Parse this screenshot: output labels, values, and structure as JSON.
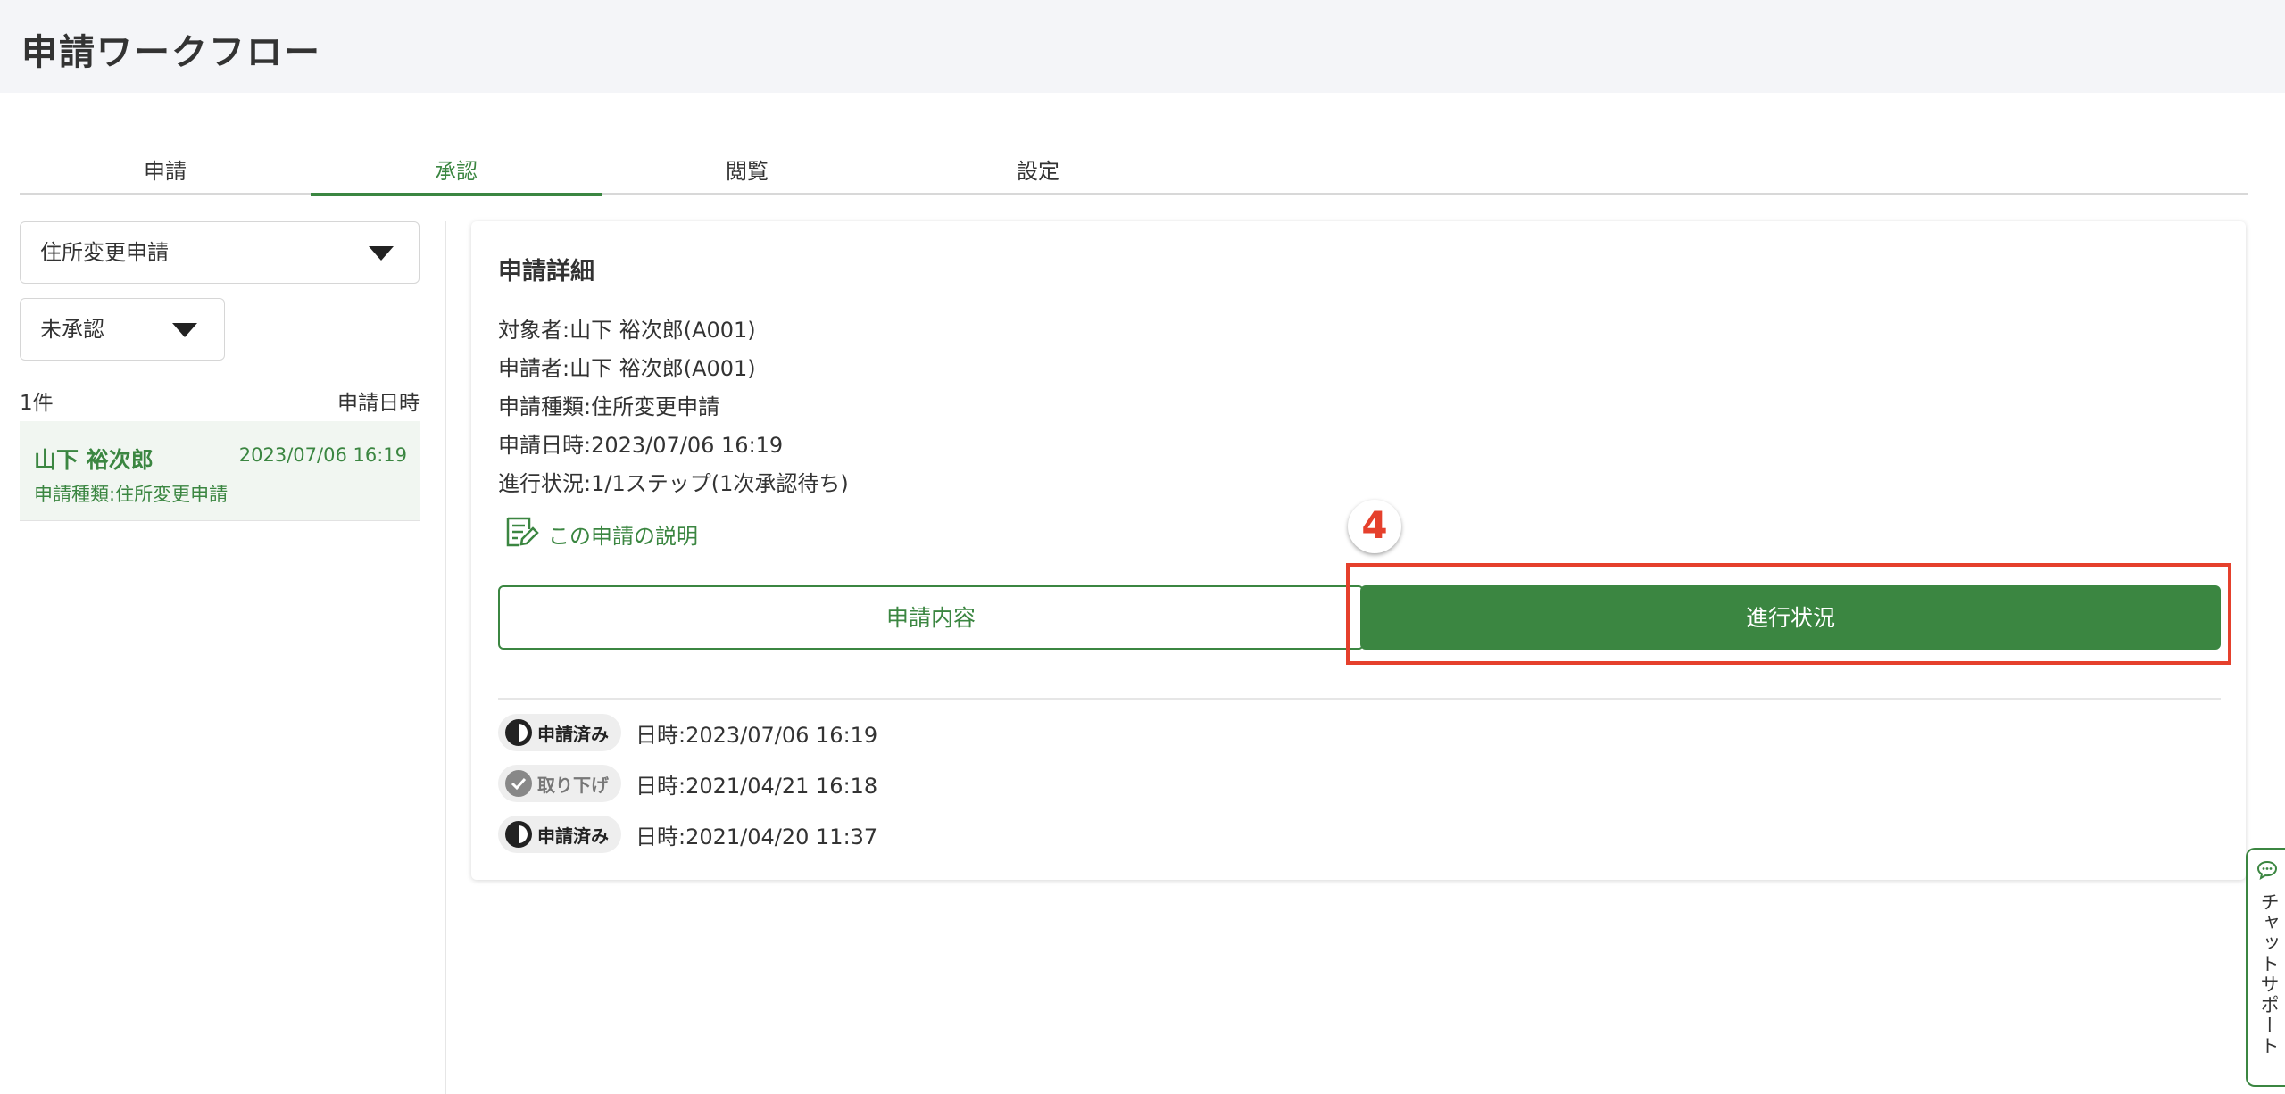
{
  "header": {
    "title": "申請ワークフロー"
  },
  "tabs": [
    {
      "label": "申請"
    },
    {
      "label": "承認"
    },
    {
      "label": "閲覧"
    },
    {
      "label": "設定"
    }
  ],
  "filters": {
    "type_select": "住所変更申請",
    "status_select": "未承認"
  },
  "list": {
    "count": "1件",
    "sort_label": "申請日時",
    "items": [
      {
        "name": "山下 裕次郎",
        "date": "2023/07/06 16:19",
        "type": "申請種類:住所変更申請"
      }
    ]
  },
  "detail": {
    "title": "申請詳細",
    "subject": "対象者:山下 裕次郎(A001)",
    "applicant": "申請者:山下 裕次郎(A001)",
    "type": "申請種類:住所変更申請",
    "date": "申請日時:2023/07/06 16:19",
    "progress": "進行状況:1/1ステップ(1次承認待ち)",
    "desc_link": "この申請の説明",
    "btn_content": "申請内容",
    "btn_progress": "進行状況",
    "marker": "4",
    "history": [
      {
        "status": "申請済み",
        "date": "日時:2023/07/06 16:19"
      },
      {
        "status": "取り下げ",
        "date": "日時:2021/04/21 16:18"
      },
      {
        "status": "申請済み",
        "date": "日時:2021/04/20 11:37"
      }
    ]
  },
  "chat": {
    "label": "チャットサポート"
  },
  "colors": {
    "accent": "#3b8641",
    "highlight": "#e5402c"
  }
}
